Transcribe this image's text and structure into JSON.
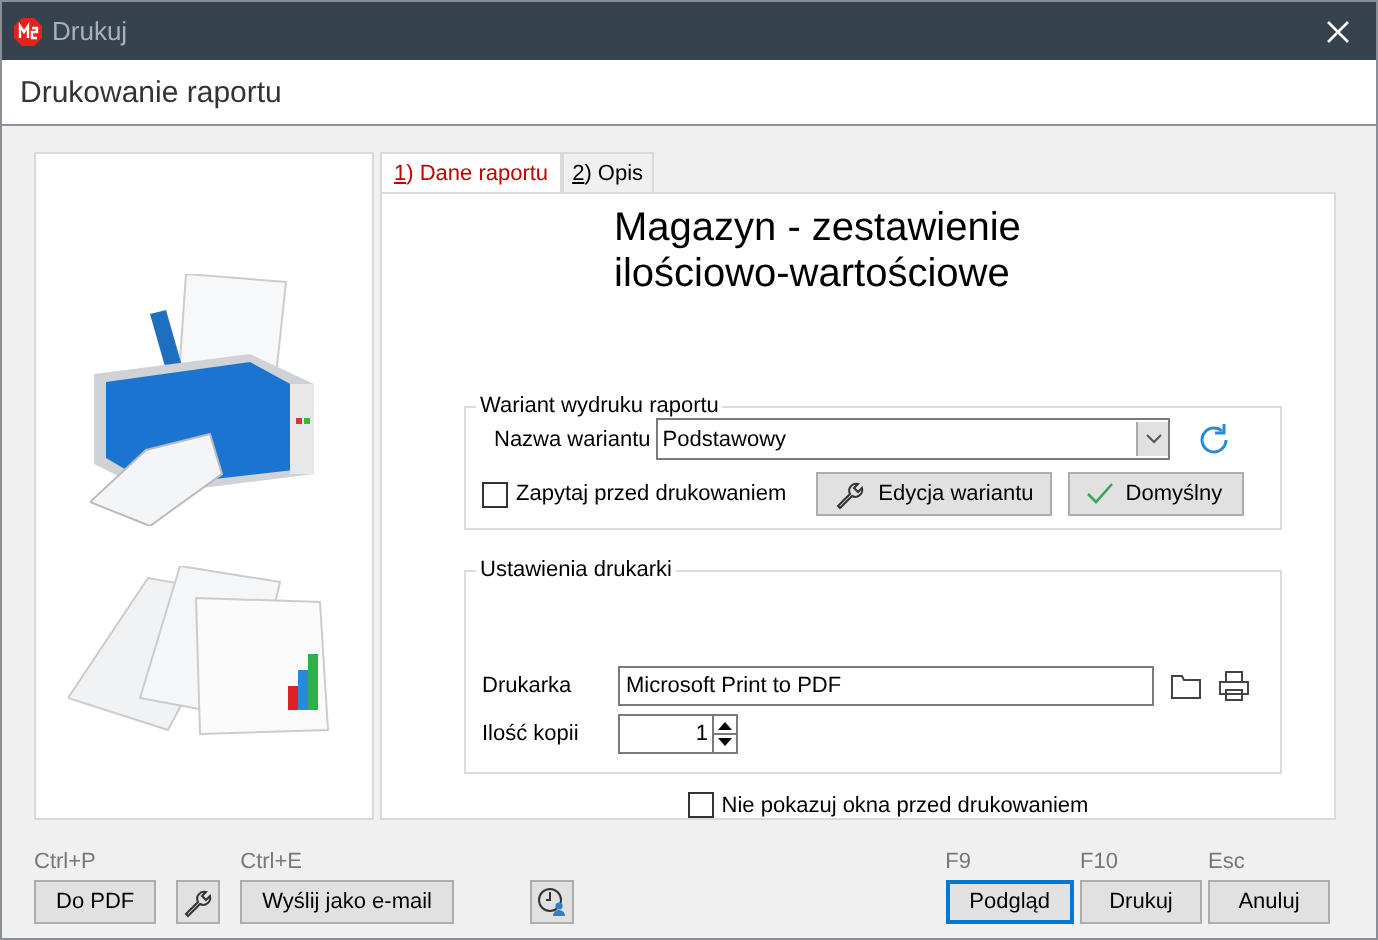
{
  "window": {
    "title": "Drukuj"
  },
  "header": "Drukowanie raportu",
  "tabs": [
    {
      "key": "1",
      "label": ") Dane raportu",
      "selected": true
    },
    {
      "key": "2",
      "label": ") Opis",
      "selected": false
    }
  ],
  "report_title": "Magazyn - zestawienie ilościowo-wartościowe",
  "variant_group": {
    "title": "Wariant wydruku raportu",
    "name_label": "Nazwa wariantu",
    "name_value": "Podstawowy",
    "ask_before_print": {
      "label": "Zapytaj przed drukowaniem",
      "checked": false
    },
    "edit_button": "Edycja wariantu",
    "default_button": "Domyślny"
  },
  "printer_group": {
    "title": "Ustawienia drukarki",
    "printer_label": "Drukarka",
    "printer_value": "Microsoft Print to PDF",
    "copies_label": "Ilość kopii",
    "copies_value": "1"
  },
  "dont_show": {
    "label": "Nie pokazuj okna przed drukowaniem",
    "checked": false
  },
  "left_buttons": [
    {
      "kind": "text",
      "shortcut": "Ctrl+P",
      "label": "Do PDF"
    },
    {
      "kind": "wrench"
    },
    {
      "kind": "text",
      "shortcut": "Ctrl+E",
      "label": "Wyślij jako e-mail"
    },
    {
      "kind": "schedule"
    }
  ],
  "right_buttons": [
    {
      "shortcut": "F9",
      "label": "Podgląd",
      "focused": true
    },
    {
      "shortcut": "F10",
      "label": "Drukuj",
      "focused": false
    },
    {
      "shortcut": "Esc",
      "label": "Anuluj",
      "focused": false
    }
  ]
}
